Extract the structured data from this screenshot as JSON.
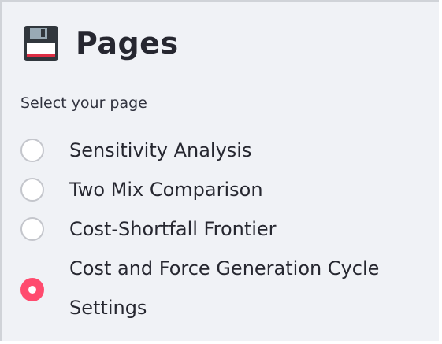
{
  "header": {
    "icon": "floppy-disk-icon",
    "title": "Pages"
  },
  "radio_group": {
    "label": "Select your page",
    "options": [
      {
        "label": "Sensitivity Analysis",
        "checked": false
      },
      {
        "label": "Two Mix Comparison",
        "checked": false
      },
      {
        "label": "Cost-Shortfall Frontier",
        "checked": false
      },
      {
        "label": "Cost and Force Generation Cycle Settings",
        "checked": true
      }
    ],
    "selected": "Cost and Force Generation Cycle Settings"
  },
  "colors": {
    "accent": "#ff4b6e",
    "panel_background": "#f0f2f6",
    "text": "#262730",
    "radio_border": "#c4c6cc"
  }
}
